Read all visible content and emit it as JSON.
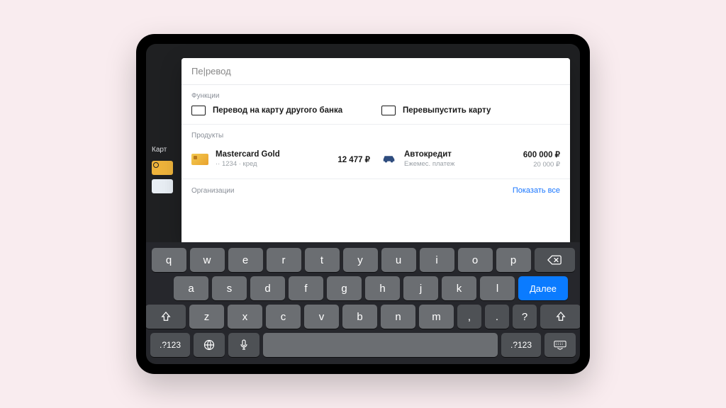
{
  "sidebar": {
    "label": "Карт"
  },
  "search": {
    "value": "Пе|ревод"
  },
  "sections": {
    "functions": "Функции",
    "products": "Продукты",
    "orgs": "Организации"
  },
  "functions": [
    {
      "label": "Перевод на карту другого банка"
    },
    {
      "label": "Перевыпустить карту"
    }
  ],
  "products": [
    {
      "name": "Mastercard Gold",
      "sub": "·· 1234 · кред",
      "amount": "12 477 ₽",
      "amount2": ""
    },
    {
      "name": "Автокредит",
      "sub": "Ежемес. платеж",
      "amount": "600 000 ₽",
      "amount2": "20 000 ₽"
    }
  ],
  "showAll": "Показать все",
  "keyboard": {
    "row1": [
      "q",
      "w",
      "e",
      "r",
      "t",
      "y",
      "u",
      "i",
      "o",
      "p"
    ],
    "row2": [
      "a",
      "s",
      "d",
      "f",
      "g",
      "h",
      "j",
      "k",
      "l"
    ],
    "row3": [
      "z",
      "x",
      "c",
      "v",
      "b",
      "n",
      "m",
      ",",
      ".",
      "?"
    ],
    "next": "Далее",
    "num": ".?123"
  }
}
